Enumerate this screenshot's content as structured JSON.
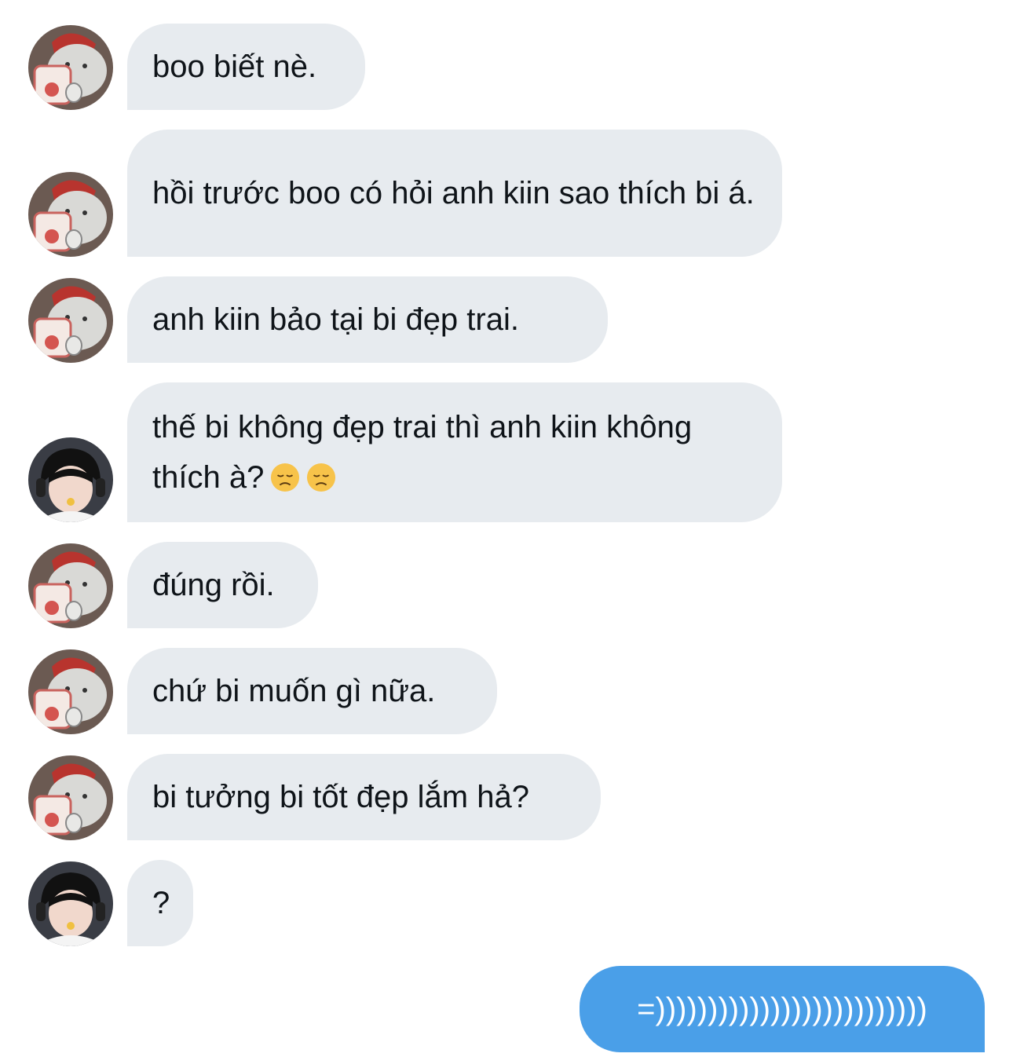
{
  "messages": [
    {
      "text": "boo biết nè.",
      "direction": "in",
      "sender": "boo"
    },
    {
      "text": "hồi trước boo có hỏi anh kiin sao thích bi á.",
      "direction": "in",
      "sender": "boo"
    },
    {
      "text": "anh kiin bảo tại bi đẹp trai.",
      "direction": "in",
      "sender": "boo"
    },
    {
      "text": "thế bi không đẹp trai thì anh kiin không thích à?",
      "emoji": [
        "disappointed-face",
        "disappointed-face"
      ],
      "direction": "in",
      "sender": "bi"
    },
    {
      "text": "đúng rồi.",
      "direction": "in",
      "sender": "boo"
    },
    {
      "text": "chứ bi muốn gì nữa.",
      "direction": "in",
      "sender": "boo"
    },
    {
      "text": "bi tưởng bi tốt đẹp lắm hả?",
      "direction": "in",
      "sender": "boo"
    },
    {
      "text": "?",
      "direction": "in",
      "sender": "bi"
    },
    {
      "text": "=))))))))))))))))))))))))))",
      "direction": "out"
    }
  ],
  "colors": {
    "incoming_bubble": "#e7ebef",
    "outgoing_bubble": "#4a9fe8",
    "text": "#0f1419"
  }
}
